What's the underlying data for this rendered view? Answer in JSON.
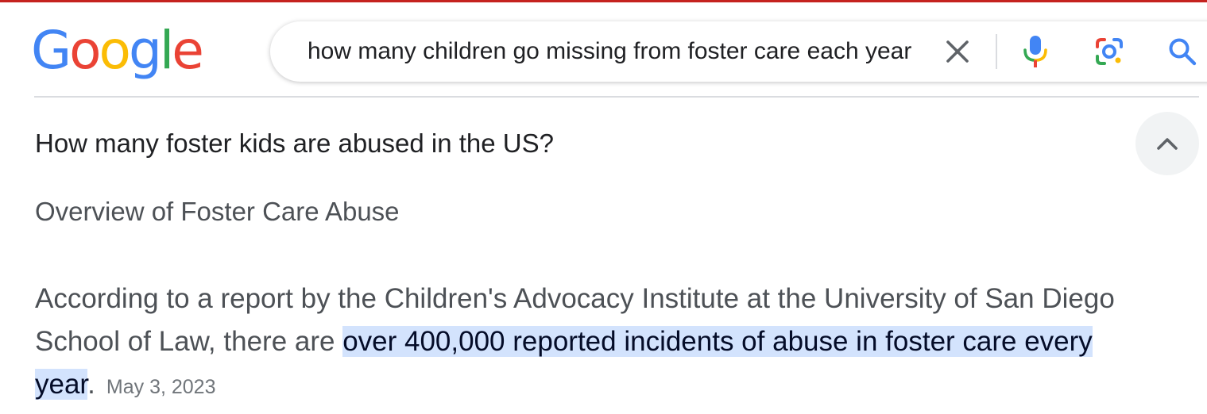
{
  "colors": {
    "top_rule": "#c5221f",
    "highlight_bg": "#d3e3fd",
    "highlight_text": "#040c28",
    "body_text": "#4d5156",
    "question_text": "#202124",
    "date_text": "#70757a"
  },
  "logo": {
    "letters": [
      {
        "char": "G",
        "color": "#4285f4"
      },
      {
        "char": "o",
        "color": "#ea4335"
      },
      {
        "char": "o",
        "color": "#fbbc05"
      },
      {
        "char": "g",
        "color": "#4285f4"
      },
      {
        "char": "l",
        "color": "#34a853"
      },
      {
        "char": "e",
        "color": "#ea4335"
      }
    ]
  },
  "search": {
    "query": "how many children go missing from foster care each year",
    "icons": [
      "close-icon",
      "microphone-icon",
      "camera-lens-icon",
      "search-icon"
    ]
  },
  "result": {
    "question": "How many foster kids are abused in the US?",
    "subheading": "Overview of Foster Care Abuse",
    "answer_plain": "According to a report by the Children's Advocacy Institute at the University of San Diego School of Law, there are ",
    "answer_highlight": "over 400,000 reported incidents of abuse in foster care every year",
    "answer_end": ".",
    "date": "May 3, 2023",
    "collapse_icon": "chevron-up-icon"
  }
}
